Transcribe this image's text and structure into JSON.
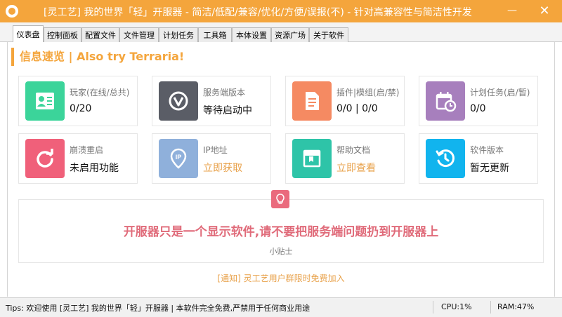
{
  "window": {
    "title": "[灵工艺] 我的世界「轻」开服器 - 简洁/低配/兼容/优化/方便/误报(不) - 针对高兼容性与简洁性开发",
    "minimize_glyph": "—",
    "close_glyph": "✕"
  },
  "tabs": [
    {
      "label": "仪表盘",
      "active": true
    },
    {
      "label": "控制面板",
      "active": false
    },
    {
      "label": "配置文件",
      "active": false
    },
    {
      "label": "文件管理",
      "active": false
    },
    {
      "label": "计划任务",
      "active": false
    },
    {
      "label": "工具箱",
      "active": false
    },
    {
      "label": "本体设置",
      "active": false
    },
    {
      "label": "资源广场",
      "active": false
    },
    {
      "label": "关于软件",
      "active": false
    }
  ],
  "dashboard": {
    "section_title": "信息速览 | Also try Terraria!",
    "cards": [
      {
        "label": "玩家(在线/总共)",
        "value": "0/20",
        "icon": "user-card-icon",
        "color": "#3bd49a"
      },
      {
        "label": "服务端版本",
        "value": "等待启动中",
        "icon": "version-v-icon",
        "color": "#5a5d66"
      },
      {
        "label": "插件|模组(启/禁)",
        "value": "0/0 | 0/0",
        "icon": "document-icon",
        "color": "#f58a62"
      },
      {
        "label": "计划任务(启/暂)",
        "value": "0/0",
        "icon": "calendar-clock-icon",
        "color": "#a77fbd"
      },
      {
        "label": "崩溃重启",
        "value": "未启用功能",
        "icon": "restart-icon",
        "color": "#f0607a"
      },
      {
        "label": "IP地址",
        "value": "立即获取",
        "icon": "ip-location-icon",
        "color": "#8fb0db"
      },
      {
        "label": "帮助文档",
        "value": "立即查看",
        "icon": "book-icon",
        "color": "#2ec4a8"
      },
      {
        "label": "软件版本",
        "value": "暂无更新",
        "icon": "history-icon",
        "color": "#11b4ee"
      }
    ],
    "notice": {
      "text": "开服器只是一个显示软件,请不要把服务端问题扔到开服器上",
      "caption": "小贴士",
      "icon": "lightbulb-icon",
      "color": "#ea6a7d"
    },
    "notify_link": "[通知] 灵工艺用户群限时免费加入"
  },
  "status": {
    "tip": "Tips: 欢迎使用 [灵工艺] 我的世界「轻」开服器 | 本软件完全免费,严禁用于任何商业用途",
    "cpu": "CPU:1%",
    "ram": "RAM:47%"
  },
  "colors": {
    "accent": "#f4a53c",
    "link": "#e8a14a",
    "notice_text": "#e06b7a"
  }
}
